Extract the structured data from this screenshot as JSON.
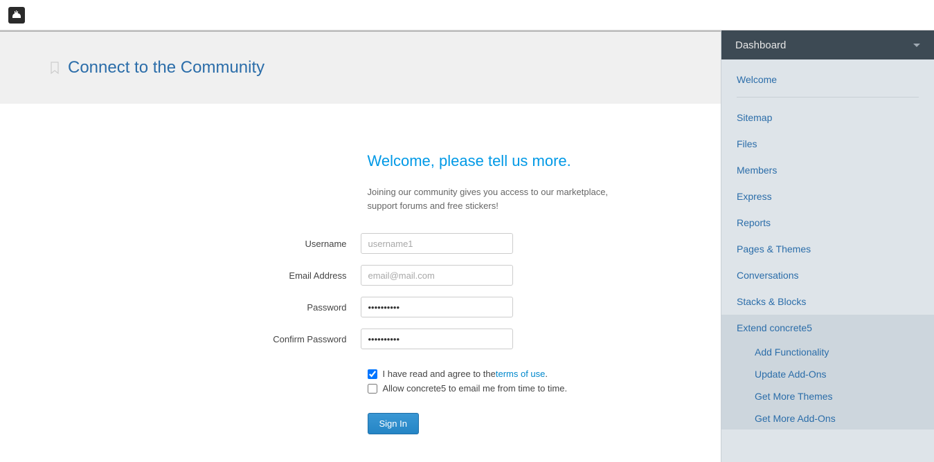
{
  "header": {
    "title": "Connect to the Community"
  },
  "welcome": {
    "heading": "Welcome, please tell us more.",
    "lead": "Joining our community gives you access to our marketplace, support forums and free stickers!"
  },
  "form": {
    "username_label": "Username",
    "username_placeholder": "username1",
    "username_value": "",
    "email_label": "Email Address",
    "email_placeholder": "email@mail.com",
    "email_value": "",
    "password_label": "Password",
    "password_value": "passwordpw",
    "confirm_label": "Confirm Password",
    "confirm_value": "passwordpw",
    "terms_prefix": "I have read and agree to the ",
    "terms_link": "terms of use",
    "terms_suffix": ".",
    "terms_checked": true,
    "email_opt_label": "Allow concrete5 to email me from time to time.",
    "email_opt_checked": false,
    "submit_label": "Sign In"
  },
  "sidebar": {
    "title": "Dashboard",
    "welcome": "Welcome",
    "links": [
      "Sitemap",
      "Files",
      "Members",
      "Express",
      "Reports",
      "Pages & Themes",
      "Conversations",
      "Stacks & Blocks"
    ],
    "extend": {
      "label": "Extend concrete5",
      "subs": [
        "Add Functionality",
        "Update Add-Ons",
        "Get More Themes",
        "Get More Add-Ons"
      ]
    }
  }
}
